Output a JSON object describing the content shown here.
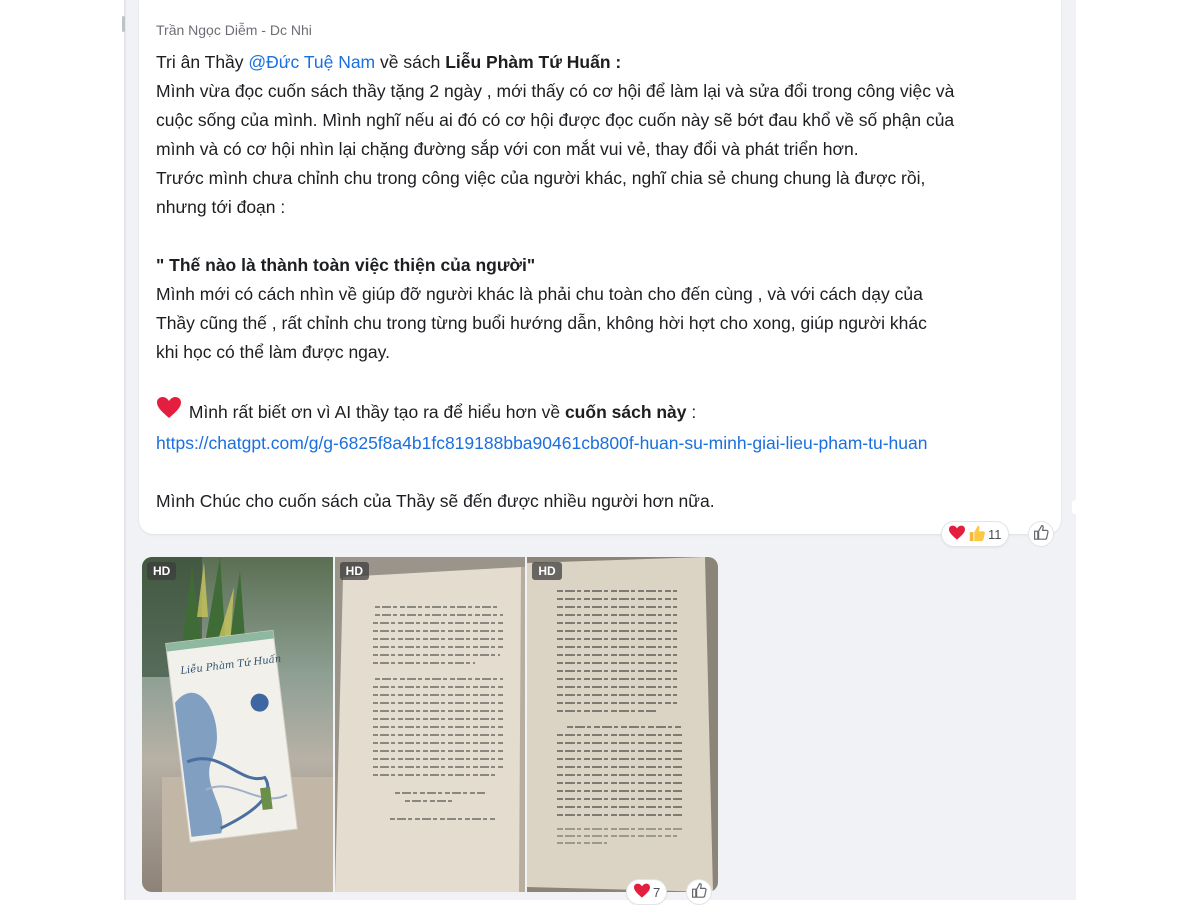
{
  "message": {
    "sender": "Trần Ngọc Diễm - Dc Nhi",
    "line1_prefix": "Tri ân Thầy ",
    "line1_mention": "@Đức Tuệ Nam",
    "line1_mid": " về sách ",
    "line1_book": "Liễu Phàm Tứ Huấn :",
    "para1": [
      "Mình vừa đọc cuốn sách thầy tặng 2 ngày , mới thấy có cơ hội để làm lại và sửa đổi trong công việc và",
      "cuộc sống của mình. Mình nghĩ nếu ai đó có cơ hội được đọc cuốn này sẽ bớt đau khổ về số phận của",
      "mình và có cơ hội nhìn lại chặng đường sắp với con mắt vui vẻ, thay đổi và phát triển hơn.",
      "Trước mình chưa chỉnh chu trong công việc của người khác, nghĩ chia sẻ chung chung là được rồi,",
      "nhưng tới đoạn :"
    ],
    "quote": "\" Thế nào là thành toàn việc thiện của người\"",
    "para2": [
      "Mình mới có cách nhìn về giúp đỡ người khác là phải chu toàn cho đến cùng , và với cách dạy của",
      "Thầy cũng thế , rất chỉnh chu trong từng buổi hướng dẫn, không hời hợt cho xong, giúp người khác",
      "khi học có thể làm được ngay."
    ],
    "thanks_prefix": " Mình rất biết ơn vì AI thầy tạo ra để hiểu hơn về ",
    "thanks_bold": "cuốn sách này",
    "thanks_suffix": " :",
    "link": "https://chatgpt.com/g/g-6825f8a4b1fc819188bba90461cb800f-huan-su-minh-giai-lieu-pham-tu-huan",
    "closing": "Mình Chúc cho cuốn sách của Thầy sẽ đến được nhiều người hơn nữa.",
    "reactions": {
      "icons": [
        "heart-icon",
        "thumbs-up-icon"
      ],
      "count": "11"
    }
  },
  "photos": {
    "badge": "HD",
    "items": [
      {
        "name": "photo-book-cover",
        "cover_title": "Liễu Phàm Tứ Huấn"
      },
      {
        "name": "photo-open-page-1"
      },
      {
        "name": "photo-open-page-2"
      }
    ],
    "reactions": {
      "icons": [
        "heart-icon"
      ],
      "count": "7"
    }
  },
  "colors": {
    "link": "#1a6fe0",
    "text": "#1c1e21",
    "feed_bg": "#f0f2f5",
    "heart": "#e41e3f"
  }
}
